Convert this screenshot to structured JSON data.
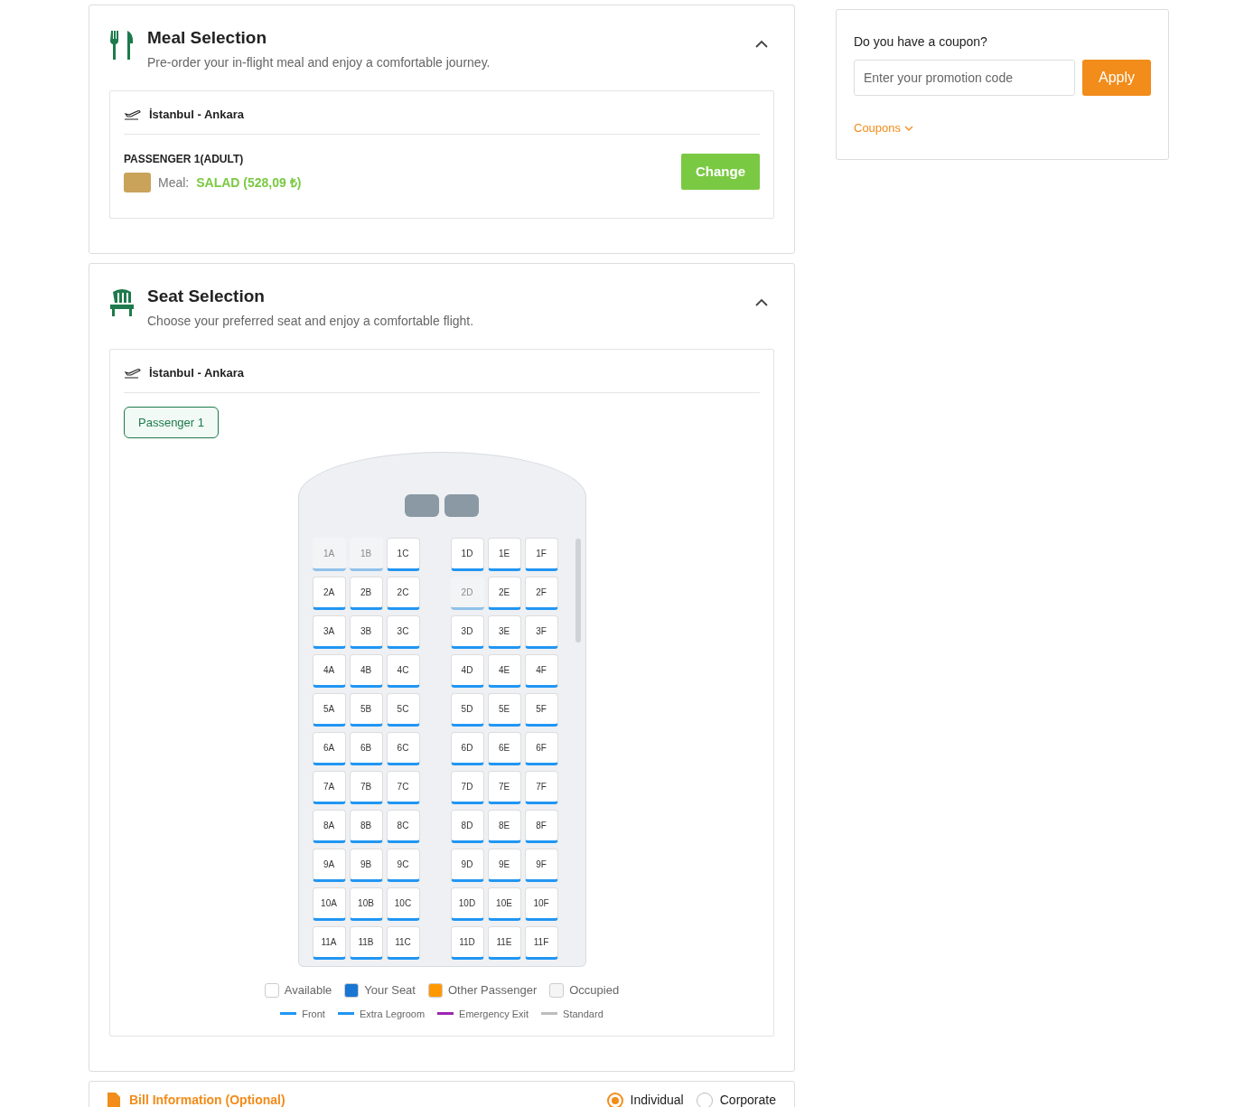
{
  "meal": {
    "title": "Meal Selection",
    "subtitle": "Pre-order your in-flight meal and enjoy a comfortable journey.",
    "expanded": true,
    "route": "İstanbul - Ankara",
    "passenger": "PASSENGER 1(ADULT)",
    "meal_label": "Meal:",
    "meal_value": "SALAD (528,09 ₺)",
    "button": "Change"
  },
  "seat": {
    "title": "Seat Selection",
    "subtitle": "Choose your preferred seat and enjoy a comfortable flight.",
    "expanded": true,
    "route": "İstanbul - Ankara",
    "passengers": [
      {
        "label": "Passenger 1",
        "selected": true
      }
    ],
    "rows": [
      {
        "seats": [
          {
            "label": "1A",
            "occupied": true
          },
          {
            "label": "1B",
            "occupied": true
          },
          {
            "label": "1C",
            "occupied": false
          },
          {
            "label": "1D",
            "occupied": false
          },
          {
            "label": "1E",
            "occupied": false
          },
          {
            "label": "1F",
            "occupied": false
          }
        ]
      },
      {
        "seats": [
          {
            "label": "2A",
            "occupied": false
          },
          {
            "label": "2B",
            "occupied": false
          },
          {
            "label": "2C",
            "occupied": false
          },
          {
            "label": "2D",
            "occupied": true
          },
          {
            "label": "2E",
            "occupied": false
          },
          {
            "label": "2F",
            "occupied": false
          }
        ]
      },
      {
        "seats": [
          {
            "label": "3A",
            "occupied": false
          },
          {
            "label": "3B",
            "occupied": false
          },
          {
            "label": "3C",
            "occupied": false
          },
          {
            "label": "3D",
            "occupied": false
          },
          {
            "label": "3E",
            "occupied": false
          },
          {
            "label": "3F",
            "occupied": false
          }
        ]
      },
      {
        "seats": [
          {
            "label": "4A",
            "occupied": false
          },
          {
            "label": "4B",
            "occupied": false
          },
          {
            "label": "4C",
            "occupied": false
          },
          {
            "label": "4D",
            "occupied": false
          },
          {
            "label": "4E",
            "occupied": false
          },
          {
            "label": "4F",
            "occupied": false
          }
        ]
      },
      {
        "seats": [
          {
            "label": "5A",
            "occupied": false
          },
          {
            "label": "5B",
            "occupied": false
          },
          {
            "label": "5C",
            "occupied": false
          },
          {
            "label": "5D",
            "occupied": false
          },
          {
            "label": "5E",
            "occupied": false
          },
          {
            "label": "5F",
            "occupied": false
          }
        ]
      },
      {
        "seats": [
          {
            "label": "6A",
            "occupied": false
          },
          {
            "label": "6B",
            "occupied": false
          },
          {
            "label": "6C",
            "occupied": false
          },
          {
            "label": "6D",
            "occupied": false
          },
          {
            "label": "6E",
            "occupied": false
          },
          {
            "label": "6F",
            "occupied": false
          }
        ]
      },
      {
        "seats": [
          {
            "label": "7A",
            "occupied": false
          },
          {
            "label": "7B",
            "occupied": false
          },
          {
            "label": "7C",
            "occupied": false
          },
          {
            "label": "7D",
            "occupied": false
          },
          {
            "label": "7E",
            "occupied": false
          },
          {
            "label": "7F",
            "occupied": false
          }
        ]
      },
      {
        "seats": [
          {
            "label": "8A",
            "occupied": false
          },
          {
            "label": "8B",
            "occupied": false
          },
          {
            "label": "8C",
            "occupied": false
          },
          {
            "label": "8D",
            "occupied": false
          },
          {
            "label": "8E",
            "occupied": false
          },
          {
            "label": "8F",
            "occupied": false
          }
        ]
      },
      {
        "seats": [
          {
            "label": "9A",
            "occupied": false
          },
          {
            "label": "9B",
            "occupied": false
          },
          {
            "label": "9C",
            "occupied": false
          },
          {
            "label": "9D",
            "occupied": false
          },
          {
            "label": "9E",
            "occupied": false
          },
          {
            "label": "9F",
            "occupied": false
          }
        ]
      },
      {
        "seats": [
          {
            "label": "10A",
            "occupied": false
          },
          {
            "label": "10B",
            "occupied": false
          },
          {
            "label": "10C",
            "occupied": false
          },
          {
            "label": "10D",
            "occupied": false
          },
          {
            "label": "10E",
            "occupied": false
          },
          {
            "label": "10F",
            "occupied": false
          }
        ]
      },
      {
        "seats": [
          {
            "label": "11A",
            "occupied": false
          },
          {
            "label": "11B",
            "occupied": false
          },
          {
            "label": "11C",
            "occupied": false
          },
          {
            "label": "11D",
            "occupied": false
          },
          {
            "label": "11E",
            "occupied": false
          },
          {
            "label": "11F",
            "occupied": false
          }
        ]
      }
    ],
    "legend": [
      {
        "kind": "box",
        "label": "Available",
        "color": "#ffffff"
      },
      {
        "kind": "box",
        "label": "Your Seat",
        "color": "#1976d2"
      },
      {
        "kind": "box",
        "label": "Other Passenger",
        "color": "#ff9800"
      },
      {
        "kind": "box",
        "label": "Occupied",
        "color": "#f5f5f5"
      }
    ],
    "legend_lines": [
      {
        "label": "Front",
        "color": "#2196f3"
      },
      {
        "label": "Extra Legroom",
        "color": "#2196f3"
      },
      {
        "label": "Emergency Exit",
        "color": "#9c27b0"
      },
      {
        "label": "Standard",
        "color": "#bdbdbd"
      }
    ]
  },
  "bill": {
    "title": "Bill Information (Optional)",
    "options": [
      {
        "label": "Individual",
        "selected": true
      },
      {
        "label": "Corporate",
        "selected": false
      }
    ]
  },
  "coupon": {
    "question": "Do you have a coupon?",
    "placeholder": "Enter your promotion code",
    "button": "Apply",
    "link": "Coupons"
  }
}
